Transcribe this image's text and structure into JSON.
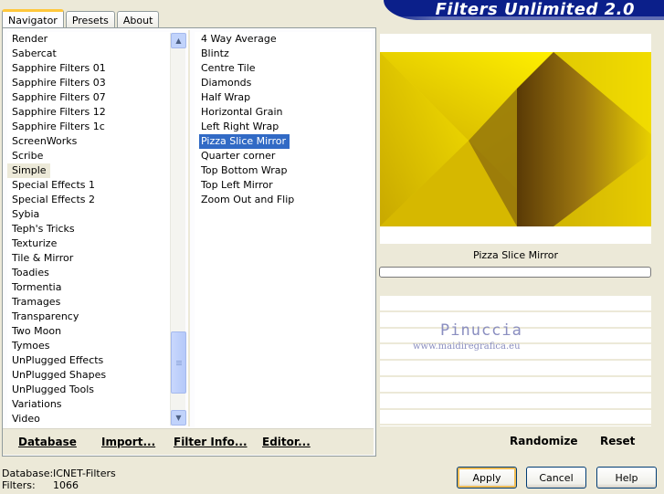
{
  "tabs": [
    {
      "label": "Navigator",
      "active": true
    },
    {
      "label": "Presets",
      "active": false
    },
    {
      "label": "About",
      "active": false
    }
  ],
  "banner": {
    "title": "Filters Unlimited 2.0"
  },
  "categories": {
    "items": [
      "Render",
      "Sabercat",
      "Sapphire Filters 01",
      "Sapphire Filters 03",
      "Sapphire Filters 07",
      "Sapphire Filters 12",
      "Sapphire Filters 1c",
      "ScreenWorks",
      "Scribe",
      "Simple",
      "Special Effects 1",
      "Special Effects 2",
      "Sybia",
      "Teph's Tricks",
      "Texturize",
      "Tile & Mirror",
      "Toadies",
      "Tormentia",
      "Tramages",
      "Transparency",
      "Two Moon",
      "Tymoes",
      "UnPlugged Effects",
      "UnPlugged Shapes",
      "UnPlugged Tools",
      "Variations",
      "Video"
    ],
    "selected": "Simple"
  },
  "filters": {
    "items": [
      "4 Way Average",
      "Blintz",
      "Centre Tile",
      "Diamonds",
      "Half Wrap",
      "Horizontal Grain",
      "Left Right Wrap",
      "Pizza Slice Mirror",
      "Quarter corner",
      "Top Bottom Wrap",
      "Top Left Mirror",
      "Zoom Out and Flip"
    ],
    "selected": "Pizza Slice Mirror"
  },
  "left_buttons": {
    "database": "Database",
    "import": "Import...",
    "filter_info": "Filter Info...",
    "editor": "Editor..."
  },
  "preview": {
    "filter_name": "Pizza Slice Mirror"
  },
  "watermark": {
    "name": "Pinuccia",
    "url": "www.maidiregrafica.eu"
  },
  "right_buttons": {
    "randomize": "Randomize",
    "reset": "Reset"
  },
  "status": {
    "database_label": "Database:",
    "database_value": "ICNET-Filters",
    "filters_label": "Filters:",
    "filters_value": "1066"
  },
  "dialog": {
    "apply": "Apply",
    "cancel": "Cancel",
    "help": "Help"
  },
  "colors": {
    "accent": "#316ac5",
    "banner": "#0b1f8a",
    "preview_yellow": "#f2dc00",
    "preview_brown": "#6a4a08"
  },
  "icons": {
    "scroll_up": "▲",
    "scroll_down": "▼"
  }
}
